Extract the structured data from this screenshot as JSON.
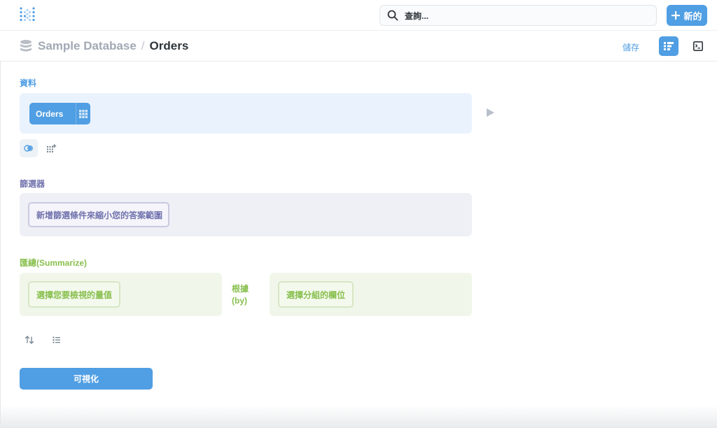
{
  "topbar": {
    "search_placeholder": "查詢...",
    "new_label": "新的",
    "icons": {
      "logo": "metabase-logo-icon",
      "search": "search-icon",
      "plus": "plus-icon"
    }
  },
  "header": {
    "database": "Sample Database",
    "separator": "/",
    "table": "Orders",
    "save_label": "儲存",
    "icons": {
      "db": "database-icon",
      "notebook": "notebook-icon",
      "sql": "sql-console-icon"
    }
  },
  "data_section": {
    "label": "資料",
    "table_pill": "Orders",
    "icons": {
      "grid": "grid-icon",
      "run": "play-icon",
      "join": "join-icon",
      "custom_column": "add-custom-column-icon"
    }
  },
  "filter_section": {
    "label": "篩選器",
    "placeholder": "新增篩選條件來縮小您的答案範圍"
  },
  "summarize_section": {
    "label": "匯總(Summarize)",
    "metric_placeholder": "選擇您要檢視的量值",
    "by_label_line1": "根據",
    "by_label_line2": "(by)",
    "breakout_placeholder": "選擇分組的欄位"
  },
  "extra_steps": {
    "icons": {
      "sort": "sort-icon",
      "limit": "limit-list-icon"
    }
  },
  "visualize_label": "可視化",
  "colors": {
    "brand": "#509ee3",
    "filter": "#7172ad",
    "summarize": "#88bf4d",
    "text_dark": "#2e353b",
    "text_muted": "#a2a9b4"
  }
}
